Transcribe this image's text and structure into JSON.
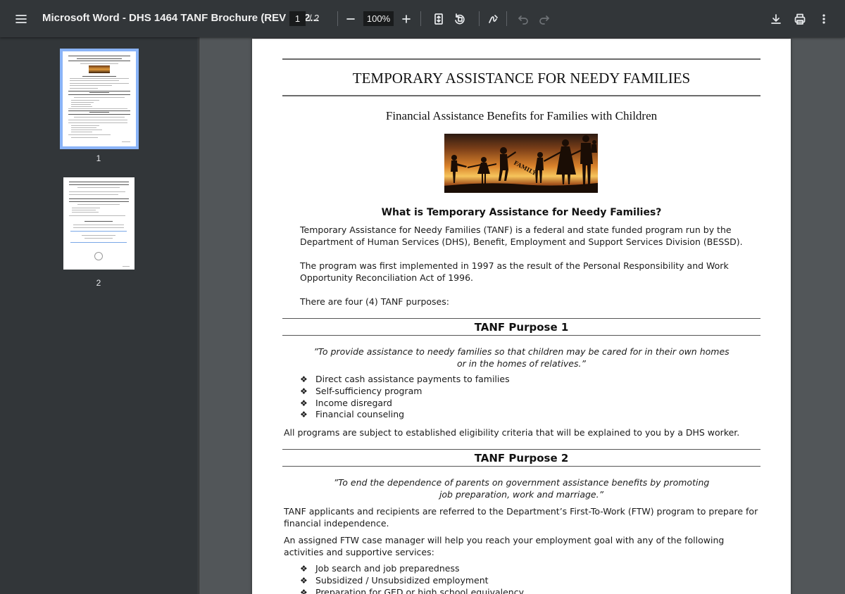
{
  "toolbar": {
    "title": "Microsoft Word - DHS 1464 TANF Brochure (REV 04-2...",
    "current_page": "1",
    "total_pages": "/ 2",
    "zoom": "100%"
  },
  "sidebar": {
    "thumbnails": [
      {
        "label": "1",
        "selected": true
      },
      {
        "label": "2",
        "selected": false
      }
    ]
  },
  "document": {
    "title": "TEMPORARY ASSISTANCE FOR NEEDY FAMILIES",
    "subtitle": "Financial Assistance Benefits for Families with Children",
    "photo_text": "FAMILY",
    "what_is_heading": "What is Temporary Assistance for Needy Families?",
    "intro_1": "Temporary Assistance for Needy Families (TANF) is a federal and state funded program run by the Department of Human Services (DHS), Benefit, Employment and Support Services Division (BESSD).",
    "intro_2": "The program was first implemented in 1997 as the result of the Personal Responsibility and Work Opportunity Reconciliation Act of 1996.",
    "intro_3": "There are four (4) TANF purposes:",
    "purpose1": {
      "heading": "TANF Purpose 1",
      "quote_line1": "”To provide assistance to needy families so that children may be cared for in their own homes",
      "quote_line2": "or in the homes of relatives.”",
      "bullets": [
        "Direct cash assistance payments to families",
        "Self-sufficiency program",
        "Income disregard",
        "Financial counseling"
      ],
      "note": "All programs are subject to established eligibility criteria that will be explained to you by a DHS worker."
    },
    "purpose2": {
      "heading": "TANF Purpose 2",
      "quote_line1": "”To end the dependence of parents on government assistance benefits by promoting",
      "quote_line2": "job preparation, work and marriage.”",
      "para_1": "TANF applicants and recipients are referred to the Department’s First-To-Work (FTW) program to prepare for financial independence.",
      "para_2": "An assigned FTW case manager will help you reach your employment goal with any of the following activities and supportive services:",
      "bullets": [
        "Job search and job preparedness",
        "Subsidized / Unsubsidized employment",
        "Preparation for GED or high school equivalency"
      ]
    }
  }
}
